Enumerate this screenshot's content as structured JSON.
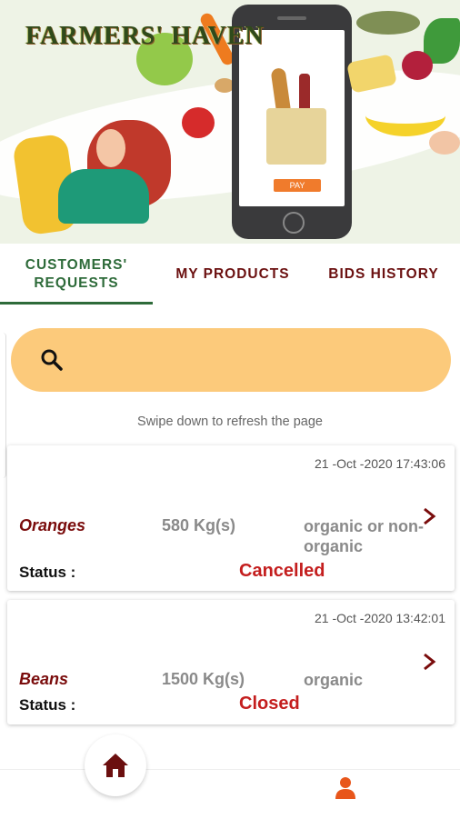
{
  "banner": {
    "brand": "FARMERS' HAVEN",
    "pay_label": "PAY"
  },
  "tabs": [
    {
      "label": "CUSTOMERS'\nREQUESTS",
      "active": true
    },
    {
      "label": "MY PRODUCTS",
      "active": false
    },
    {
      "label": "BIDS HISTORY",
      "active": false
    }
  ],
  "search": {
    "placeholder": ""
  },
  "refresh_hint": "Swipe down to refresh the page",
  "requests": [
    {
      "date": "21 -Oct -2020 17:43:06",
      "product": "Oranges",
      "quantity": "580 Kg(s)",
      "type": "organic or non-organic",
      "status_label": "Status :",
      "status": "Cancelled"
    },
    {
      "date": "21 -Oct -2020 13:42:01",
      "product": "Beans",
      "quantity": "1500 Kg(s)",
      "type": "organic",
      "status_label": "Status :",
      "status": "Closed"
    }
  ],
  "colors": {
    "accent_green": "#2e6b3a",
    "tab_text": "#6b1010",
    "search_bg": "#fcca7b",
    "status_red": "#c41e1e",
    "product_red": "#7a0c0c",
    "profile_orange": "#e8561b"
  },
  "icons": {
    "search": "search-icon",
    "chevron": "chevron-right-icon",
    "home": "home-icon",
    "profile": "profile-icon"
  }
}
